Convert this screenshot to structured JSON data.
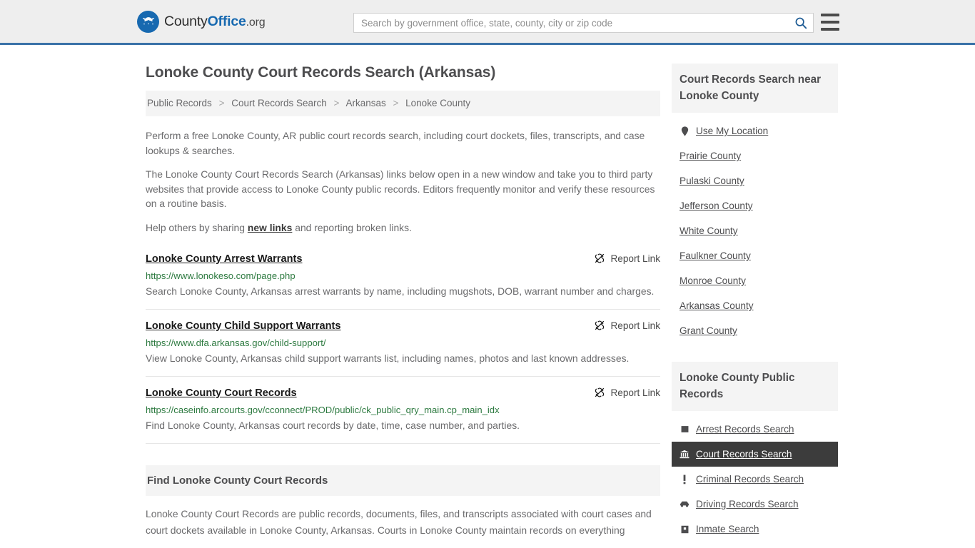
{
  "header": {
    "logo": {
      "part1": "County",
      "part2": "Office",
      "part3": ".org",
      "icon": "eagle-emblem-icon"
    },
    "search": {
      "placeholder": "Search by government office, state, county, city or zip code",
      "value": "",
      "button_icon": "search-icon"
    },
    "menu_icon": "hamburger-menu-icon",
    "accent_color": "#3a72a8",
    "background": "#eeeeee"
  },
  "main": {
    "title": "Lonoke County Court Records Search (Arkansas)",
    "breadcrumb": {
      "separator": ">",
      "items": [
        {
          "label": "Public Records"
        },
        {
          "label": "Court Records Search"
        },
        {
          "label": "Arkansas"
        },
        {
          "label": "Lonoke County"
        }
      ]
    },
    "intro": {
      "p1": "Perform a free Lonoke County, AR public court records search, including court dockets, files, transcripts, and case lookups & searches.",
      "p2": "The Lonoke County Court Records Search (Arkansas) links below open in a new window and take you to third party websites that provide access to Lonoke County public records. Editors frequently monitor and verify these resources on a routine basis.",
      "p3_before": "Help others by sharing ",
      "p3_link": "new links",
      "p3_after": " and reporting broken links."
    },
    "report_link_label": "Report Link",
    "report_link_icon": "broken-link-icon",
    "results": [
      {
        "title": "Lonoke County Arrest Warrants",
        "url": "https://www.lonokeso.com/page.php",
        "description": "Search Lonoke County, Arkansas arrest warrants by name, including mugshots, DOB, warrant number and charges."
      },
      {
        "title": "Lonoke County Child Support Warrants",
        "url": "https://www.dfa.arkansas.gov/child-support/",
        "description": "View Lonoke County, Arkansas child support warrants list, including names, photos and last known addresses."
      },
      {
        "title": "Lonoke County Court Records",
        "url": "https://caseinfo.arcourts.gov/cconnect/PROD/public/ck_public_qry_main.cp_main_idx",
        "description": "Find Lonoke County, Arkansas court records by date, time, case number, and parties."
      }
    ],
    "find_section": {
      "heading": "Find Lonoke County Court Records",
      "body": "Lonoke County Court Records are public records, documents, files, and transcripts associated with court cases and court dockets available in Lonoke County, Arkansas. Courts in Lonoke County maintain records on everything"
    }
  },
  "sidebar": {
    "nearby": {
      "heading": "Court Records Search near Lonoke County",
      "items": [
        {
          "label": "Use My Location",
          "icon": "location-pin-icon"
        },
        {
          "label": "Prairie County",
          "icon": ""
        },
        {
          "label": "Pulaski County",
          "icon": ""
        },
        {
          "label": "Jefferson County",
          "icon": ""
        },
        {
          "label": "White County",
          "icon": ""
        },
        {
          "label": "Faulkner County",
          "icon": ""
        },
        {
          "label": "Monroe County",
          "icon": ""
        },
        {
          "label": "Arkansas County",
          "icon": ""
        },
        {
          "label": "Grant County",
          "icon": ""
        }
      ]
    },
    "public_records": {
      "heading": "Lonoke County Public Records",
      "active_label": "Court Records Search",
      "active_background": "#3c3c3c",
      "items": [
        {
          "label": "Arrest Records Search",
          "icon": "square-icon",
          "active": false
        },
        {
          "label": "Court Records Search",
          "icon": "courthouse-icon",
          "active": true
        },
        {
          "label": "Criminal Records Search",
          "icon": "exclamation-icon",
          "active": false
        },
        {
          "label": "Driving Records Search",
          "icon": "car-icon",
          "active": false
        },
        {
          "label": "Inmate Search",
          "icon": "jail-icon",
          "active": false
        }
      ]
    }
  }
}
